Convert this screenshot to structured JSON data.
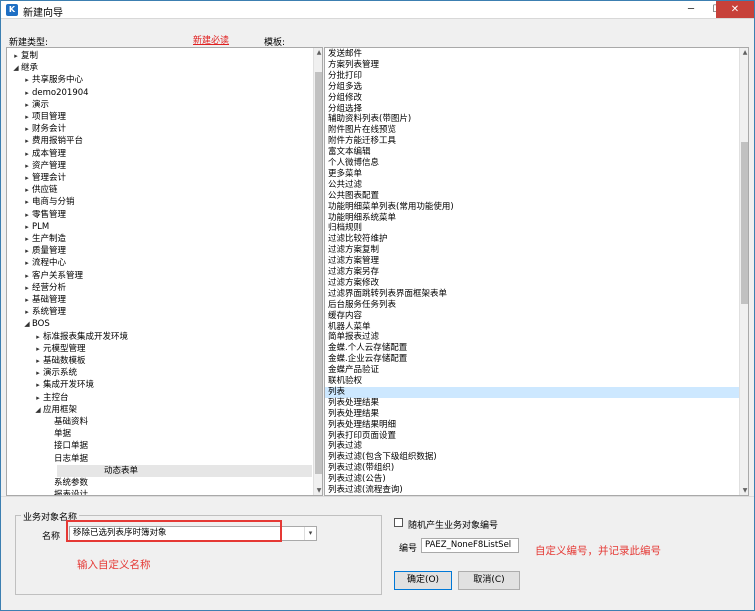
{
  "window": {
    "title": "新建向导",
    "minimize": "─",
    "maximize": "☐",
    "close": "✕"
  },
  "labels": {
    "new_type": "新建类型:",
    "template": "模板:",
    "new_required": "新建必读"
  },
  "tree": [
    {
      "label": "复制",
      "level": 0,
      "arrow": "▸"
    },
    {
      "label": "继承",
      "level": 0,
      "arrow": "◢"
    },
    {
      "label": "共享服务中心",
      "level": 1,
      "arrow": "▸"
    },
    {
      "label": "demo201904",
      "level": 1,
      "arrow": "▸"
    },
    {
      "label": "演示",
      "level": 1,
      "arrow": "▸"
    },
    {
      "label": "项目管理",
      "level": 1,
      "arrow": "▸"
    },
    {
      "label": "财务会计",
      "level": 1,
      "arrow": "▸"
    },
    {
      "label": "费用报销平台",
      "level": 1,
      "arrow": "▸"
    },
    {
      "label": "成本管理",
      "level": 1,
      "arrow": "▸"
    },
    {
      "label": "资产管理",
      "level": 1,
      "arrow": "▸"
    },
    {
      "label": "管理会计",
      "level": 1,
      "arrow": "▸"
    },
    {
      "label": "供应链",
      "level": 1,
      "arrow": "▸"
    },
    {
      "label": "电商与分销",
      "level": 1,
      "arrow": "▸"
    },
    {
      "label": "零售管理",
      "level": 1,
      "arrow": "▸"
    },
    {
      "label": "PLM",
      "level": 1,
      "arrow": "▸"
    },
    {
      "label": "生产制造",
      "level": 1,
      "arrow": "▸"
    },
    {
      "label": "质量管理",
      "level": 1,
      "arrow": "▸"
    },
    {
      "label": "流程中心",
      "level": 1,
      "arrow": "▸"
    },
    {
      "label": "客户关系管理",
      "level": 1,
      "arrow": "▸"
    },
    {
      "label": "经营分析",
      "level": 1,
      "arrow": "▸"
    },
    {
      "label": "基础管理",
      "level": 1,
      "arrow": "▸"
    },
    {
      "label": "系统管理",
      "level": 1,
      "arrow": "▸"
    },
    {
      "label": "BOS",
      "level": 1,
      "arrow": "◢"
    },
    {
      "label": "标准报表集成开发环境",
      "level": 2,
      "arrow": "▸"
    },
    {
      "label": "元模型管理",
      "level": 2,
      "arrow": "▸"
    },
    {
      "label": "基础数模板",
      "level": 2,
      "arrow": "▸"
    },
    {
      "label": "演示系统",
      "level": 2,
      "arrow": "▸"
    },
    {
      "label": "集成开发环境",
      "level": 2,
      "arrow": "▸"
    },
    {
      "label": "主控台",
      "level": 2,
      "arrow": "▸"
    },
    {
      "label": "应用框架",
      "level": 2,
      "arrow": "◢"
    },
    {
      "label": "基础资料",
      "level": 3,
      "arrow": ""
    },
    {
      "label": "单据",
      "level": 3,
      "arrow": ""
    },
    {
      "label": "接口单据",
      "level": 3,
      "arrow": ""
    },
    {
      "label": "日志单据",
      "level": 3,
      "arrow": ""
    },
    {
      "label": "动态表单",
      "level": 3,
      "arrow": "",
      "selected": true
    },
    {
      "label": "系统参数",
      "level": 3,
      "arrow": ""
    },
    {
      "label": "报表设计",
      "level": 3,
      "arrow": ""
    }
  ],
  "templates": [
    {
      "label": "发送邮件"
    },
    {
      "label": "方案列表管理"
    },
    {
      "label": "分批打印"
    },
    {
      "label": "分组多选"
    },
    {
      "label": "分组修改"
    },
    {
      "label": "分组选择"
    },
    {
      "label": "辅助资料列表(带图片)"
    },
    {
      "label": "附件图片在线预览"
    },
    {
      "label": "附件方能迁移工具"
    },
    {
      "label": "富文本编辑"
    },
    {
      "label": "个人微博信息"
    },
    {
      "label": "更多菜单"
    },
    {
      "label": "公共过滤"
    },
    {
      "label": "公共图表配置"
    },
    {
      "label": "功能明细菜单列表(常用功能使用)"
    },
    {
      "label": "功能明细系统菜单"
    },
    {
      "label": "归档规则"
    },
    {
      "label": "过滤比较符维护"
    },
    {
      "label": "过滤方案复制"
    },
    {
      "label": "过滤方案管理"
    },
    {
      "label": "过滤方案另存"
    },
    {
      "label": "过滤方案修改"
    },
    {
      "label": "过滤界面跳转列表界面框架表单"
    },
    {
      "label": "后台服务任务列表"
    },
    {
      "label": "缓存内容"
    },
    {
      "label": "机器人菜单"
    },
    {
      "label": "简单报表过滤"
    },
    {
      "label": "金蝶.个人云存储配置"
    },
    {
      "label": "金蝶.企业云存储配置"
    },
    {
      "label": "金蝶产品验证"
    },
    {
      "label": "联机验权"
    },
    {
      "label": "列表",
      "selected": true
    },
    {
      "label": "列表处理结果"
    },
    {
      "label": "列表处理结果"
    },
    {
      "label": "列表处理结果明细"
    },
    {
      "label": "列表打印页面设置"
    },
    {
      "label": "列表过滤"
    },
    {
      "label": "列表过滤(包含下级组织数据)"
    },
    {
      "label": "列表过滤(带组织)"
    },
    {
      "label": "列表过滤(公告)"
    },
    {
      "label": "列表过滤(流程查询)"
    }
  ],
  "business": {
    "group_title": "业务对象名称",
    "name_label": "名称",
    "name_value": "移除已选列表序时簿对象",
    "combo_arrow": "▾",
    "random_checkbox_label": "随机产生业务对象编号",
    "random_checked": false,
    "code_label": "编号",
    "code_value": "PAEZ_NoneF8ListSel"
  },
  "annotations": {
    "name_hint": "输入自定义名称",
    "code_hint": "自定义编号，并记录此编号"
  },
  "buttons": {
    "ok": "确定(O)",
    "cancel": "取消(C)"
  },
  "colors": {
    "accent": "#0078d7",
    "annotation": "#e53935",
    "selection": "#cde8ff"
  }
}
